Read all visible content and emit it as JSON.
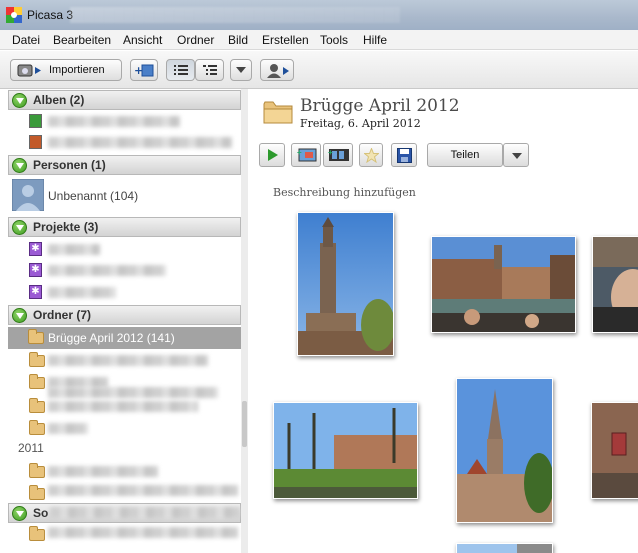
{
  "window": {
    "title": "Picasa 3"
  },
  "menu": [
    "Datei",
    "Bearbeiten",
    "Ansicht",
    "Ordner",
    "Bild",
    "Erstellen",
    "Tools",
    "Hilfe"
  ],
  "toolbar": {
    "import_label": "Importieren"
  },
  "sections": {
    "albums": "Alben (2)",
    "people": "Personen (1)",
    "people_unnamed": "Unbenannt (104)",
    "projects": "Projekte (3)",
    "folders": "Ordner (7)",
    "selected_folder": "Brügge April 2012 (141)",
    "year_2011": "2011",
    "other": "So"
  },
  "album": {
    "title": "Brügge April 2012",
    "date": "Freitag, 6. April 2012",
    "caption_placeholder": "Beschreibung hinzufügen",
    "share_label": "Teilen"
  },
  "icons": {
    "play": "play-icon",
    "collage": "collage-icon",
    "movie": "movie-icon",
    "star": "star-icon",
    "save": "save-icon",
    "dropdown": "chevron-down-icon"
  },
  "colors": {
    "selected_row": "#a3a3a3",
    "section_arrow": "#3f9d22",
    "title_bar": "#a9b8cb"
  }
}
